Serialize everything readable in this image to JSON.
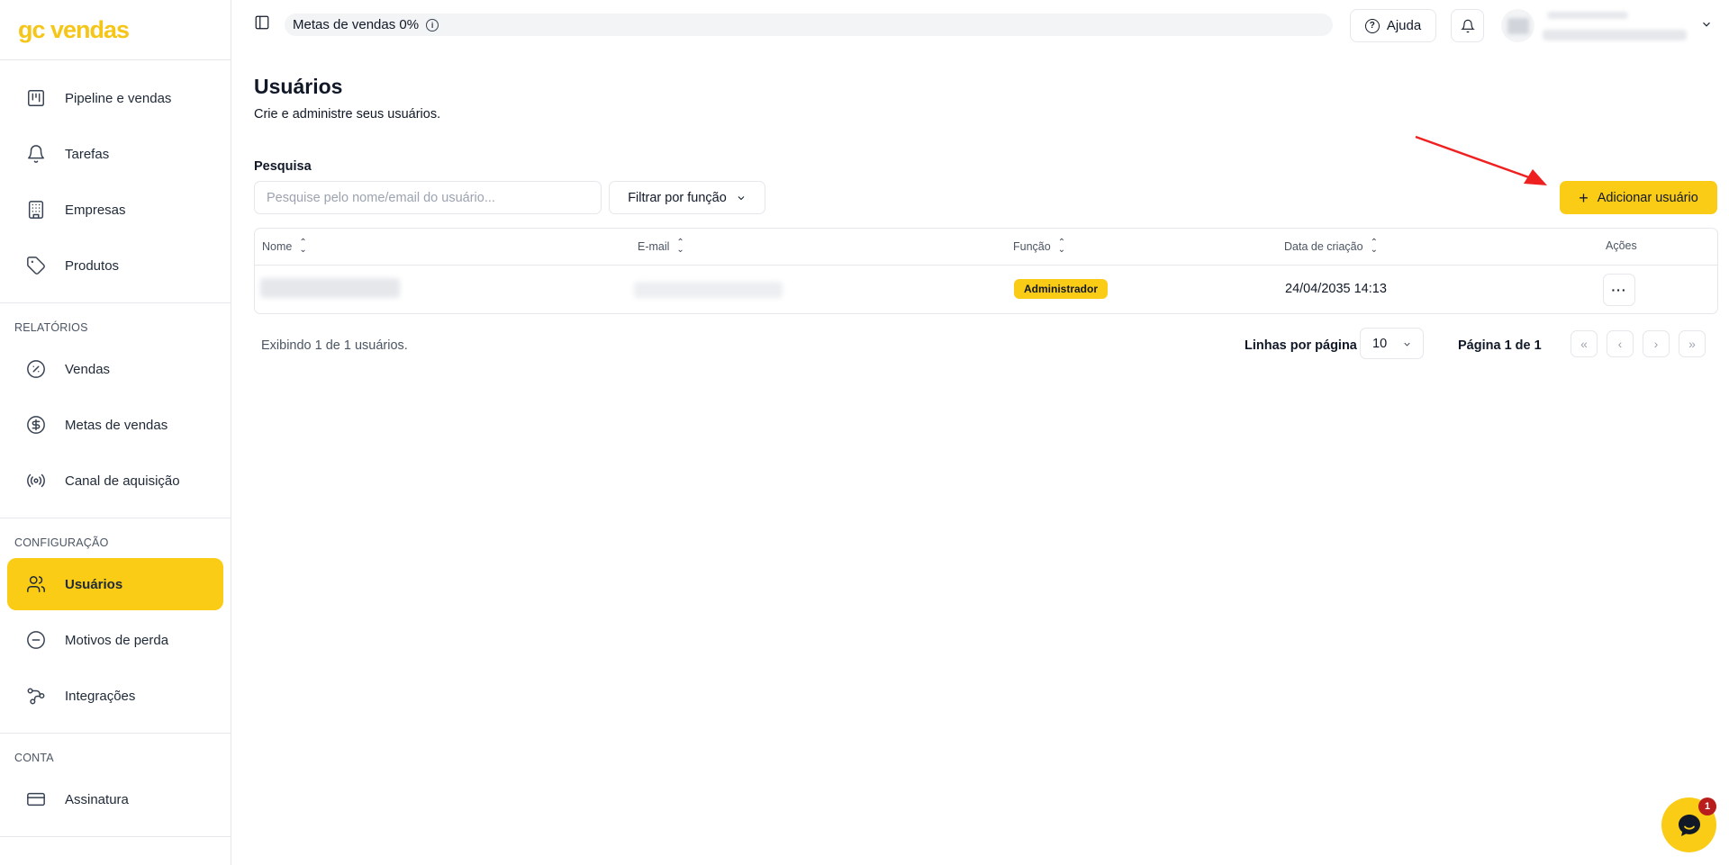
{
  "app": {
    "logo": "gc vendas"
  },
  "sidebar": {
    "main_items": [
      {
        "label": "Pipeline e vendas",
        "icon": "kanban-icon"
      },
      {
        "label": "Tarefas",
        "icon": "bell-icon"
      },
      {
        "label": "Empresas",
        "icon": "building-icon"
      },
      {
        "label": "Produtos",
        "icon": "tag-icon"
      }
    ],
    "reports_title": "Relatórios",
    "reports_items": [
      {
        "label": "Vendas",
        "icon": "percent-icon"
      },
      {
        "label": "Metas de vendas",
        "icon": "dollar-icon"
      },
      {
        "label": "Canal de aquisição",
        "icon": "radio-icon"
      }
    ],
    "config_title": "Configuração",
    "config_items": [
      {
        "label": "Usuários",
        "icon": "users-icon",
        "active": true
      },
      {
        "label": "Motivos de perda",
        "icon": "minus-circle-icon"
      },
      {
        "label": "Integrações",
        "icon": "workflow-icon"
      }
    ],
    "account_title": "Conta",
    "account_items": [
      {
        "label": "Assinatura",
        "icon": "credit-card-icon"
      }
    ]
  },
  "topbar": {
    "goal_label": "Metas de vendas 0%",
    "help_label": "Ajuda"
  },
  "page": {
    "title": "Usuários",
    "subtitle": "Crie e administre seus usuários.",
    "search_label": "Pesquisa",
    "search_placeholder": "Pesquise pelo nome/email do usuário...",
    "filter_label": "Filtrar por função",
    "add_button": "Adicionar usuário"
  },
  "table": {
    "columns": [
      "Nome",
      "E-mail",
      "Função",
      "Data de criação",
      "Ações"
    ],
    "rows": [
      {
        "role": "Administrador",
        "created": "24/04/2035 14:13"
      }
    ]
  },
  "pagination": {
    "showing": "Exibindo 1 de 1 usuários.",
    "rows_label": "Linhas por página",
    "rows_value": "10",
    "page_info": "Página 1 de 1"
  },
  "chat": {
    "badge": "1"
  },
  "colors": {
    "accent": "#facc15",
    "annotation_arrow": "#ef2020",
    "badge": "#b91c1c"
  }
}
